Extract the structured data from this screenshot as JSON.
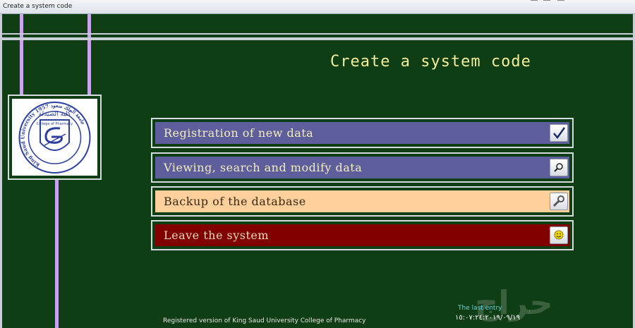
{
  "window": {
    "title": "Create a system code"
  },
  "page": {
    "title": "Create a system code"
  },
  "logo": {
    "arabic_top": "كلية الصيدلة",
    "english_top": "College of Pharmacy",
    "ring_text": "King Saud University 1957 جامعة الملك سعود"
  },
  "menu": [
    {
      "label": "Registration of new data",
      "icon": "checkmark-icon",
      "bar_color": "#5e5e9c",
      "text_color": "#f2eec0"
    },
    {
      "label": "Viewing, search and modify data",
      "icon": "magnifier-icon",
      "bar_color": "#5e5e9c",
      "text_color": "#f2eec0"
    },
    {
      "label": "Backup of the database",
      "icon": "wrench-icon",
      "bar_color": "#ffcf9c",
      "text_color": "#3a2a10"
    },
    {
      "label": "Leave the system",
      "icon": "smiley-icon",
      "bar_color": "#800000",
      "text_color": "#f0d8b0"
    }
  ],
  "footer": {
    "note": "Registered version of King Saud University College of Pharmacy"
  },
  "last_entry": {
    "label": "The last entry",
    "value": "١٥:٠٧:٢٤:٢٠١٩/٠٩/١٩"
  },
  "watermark": {
    "text": "حراج"
  }
}
